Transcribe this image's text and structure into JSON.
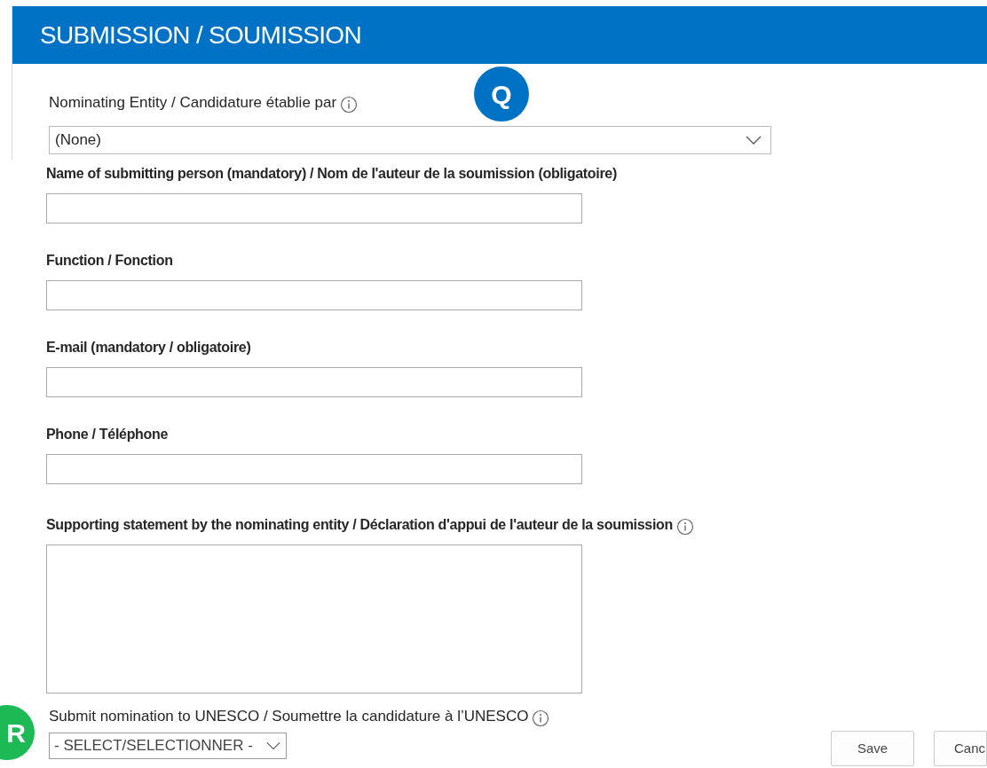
{
  "header": {
    "title": "SUBMISSION / SOUMISSION"
  },
  "badges": [
    {
      "label": "Q",
      "color": "#0072c6",
      "kind": "top"
    },
    {
      "label": "R",
      "color": "#1db954",
      "kind": "left"
    }
  ],
  "nominating": {
    "label": "Nominating Entity / Candidature établie par",
    "info": true,
    "value": "(None)"
  },
  "fields": [
    {
      "kind": "text",
      "label": "Name of submitting person (mandatory) / Nom de l'auteur de la soumission (obligatoire)"
    },
    {
      "kind": "text",
      "label": "Function / Fonction"
    },
    {
      "kind": "text",
      "label": "E-mail (mandatory / obligatoire)"
    },
    {
      "kind": "text",
      "label": "Phone / Téléphone"
    },
    {
      "kind": "textarea",
      "label": "Supporting statement by the nominating entity / Déclaration d'appui de l'auteur de la soumission",
      "info": true
    }
  ],
  "submit": {
    "label": "Submit nomination to UNESCO / Soumettre la candidature à l’UNESCO",
    "info": true,
    "value": "- SELECT/SELECTIONNER -"
  },
  "buttons": [
    "Save",
    "Canc"
  ]
}
